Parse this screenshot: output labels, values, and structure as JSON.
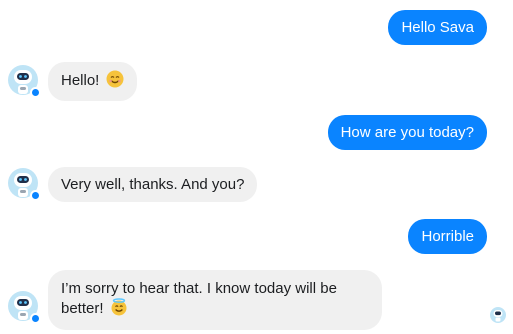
{
  "messages": [
    {
      "side": "outgoing",
      "text": "Hello Sava"
    },
    {
      "side": "incoming",
      "text": "Hello!",
      "emoji": "smiling-face-icon"
    },
    {
      "side": "outgoing",
      "text": "How are you today?"
    },
    {
      "side": "incoming",
      "text": "Very well, thanks. And you?"
    },
    {
      "side": "outgoing",
      "text": "Horrible"
    },
    {
      "side": "incoming",
      "text": "I’m sorry to hear that. I know today will be better!",
      "emoji": "smiling-halo-face-icon"
    }
  ],
  "colors": {
    "outgoing_bubble": "#0a84ff",
    "incoming_bubble": "#f0f0f0",
    "incoming_text": "#1c1e21",
    "badge": "#0a84ff"
  },
  "icons": {
    "avatar": "robot-avatar-icon",
    "badge": "messenger-badge-icon",
    "seen": "seen-avatar-icon"
  }
}
